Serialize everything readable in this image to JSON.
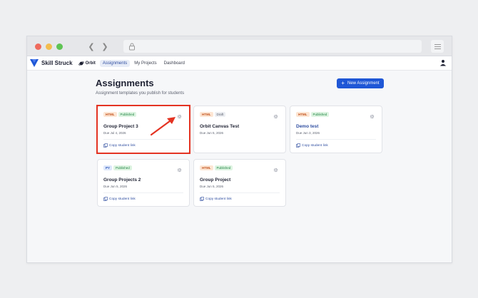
{
  "nav": {
    "brand": "Skill Struck",
    "orbit": "Orbit",
    "links": [
      "Assignments",
      "My Projects",
      "Dashboard"
    ]
  },
  "page": {
    "title": "Assignments",
    "subtitle": "Assignment templates you publish for students",
    "new_button": "New Assignment"
  },
  "cards": [
    {
      "lang": "HTML",
      "status": "Published",
      "title": "Group Project 3",
      "due": "Due Jul 4, 2026",
      "copy": "Copy student link"
    },
    {
      "lang": "HTML",
      "status": "Draft",
      "title": "Orbit Canvas Test",
      "due": "Due Jun 5, 2026",
      "copy": ""
    },
    {
      "lang": "HTML",
      "status": "Published",
      "title": "Demo test",
      "due": "Due Jun 3, 2026",
      "copy": "Copy student link"
    },
    {
      "lang": "PY",
      "status": "Published",
      "title": "Group Projects 2",
      "due": "Due Jun 5, 2026",
      "copy": "Copy student link"
    },
    {
      "lang": "HTML",
      "status": "Published",
      "title": "Group Project",
      "due": "Due Jun 5, 2026",
      "copy": "Copy student link"
    }
  ],
  "colors": {
    "accent": "#1f57d6",
    "highlight": "#e43322"
  }
}
